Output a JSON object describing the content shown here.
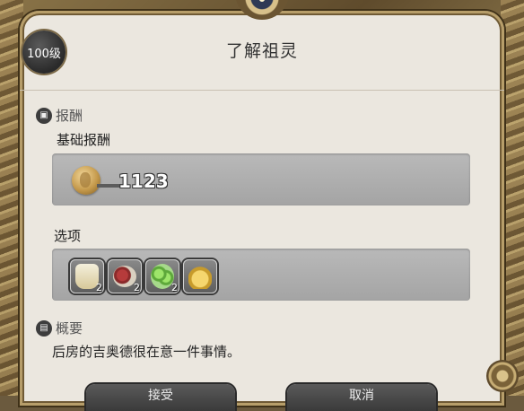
{
  "header": {
    "level_badge": "100级",
    "title": "了解祖灵"
  },
  "rewards": {
    "section_title": "报酬",
    "base_label": "基础报酬",
    "gil_amount": "1123",
    "options_label": "选项",
    "items": [
      {
        "icon": "bottle-icon",
        "qty": "2"
      },
      {
        "icon": "meat-dish-icon",
        "qty": "2"
      },
      {
        "icon": "grapes-icon",
        "qty": "2"
      },
      {
        "icon": "coin-pouch-icon",
        "qty": ""
      }
    ]
  },
  "summary": {
    "section_title": "概要",
    "text": "后房的吉奥德很在意一件事情。"
  },
  "buttons": {
    "accept_label": "接受",
    "cancel_label": "取消"
  }
}
